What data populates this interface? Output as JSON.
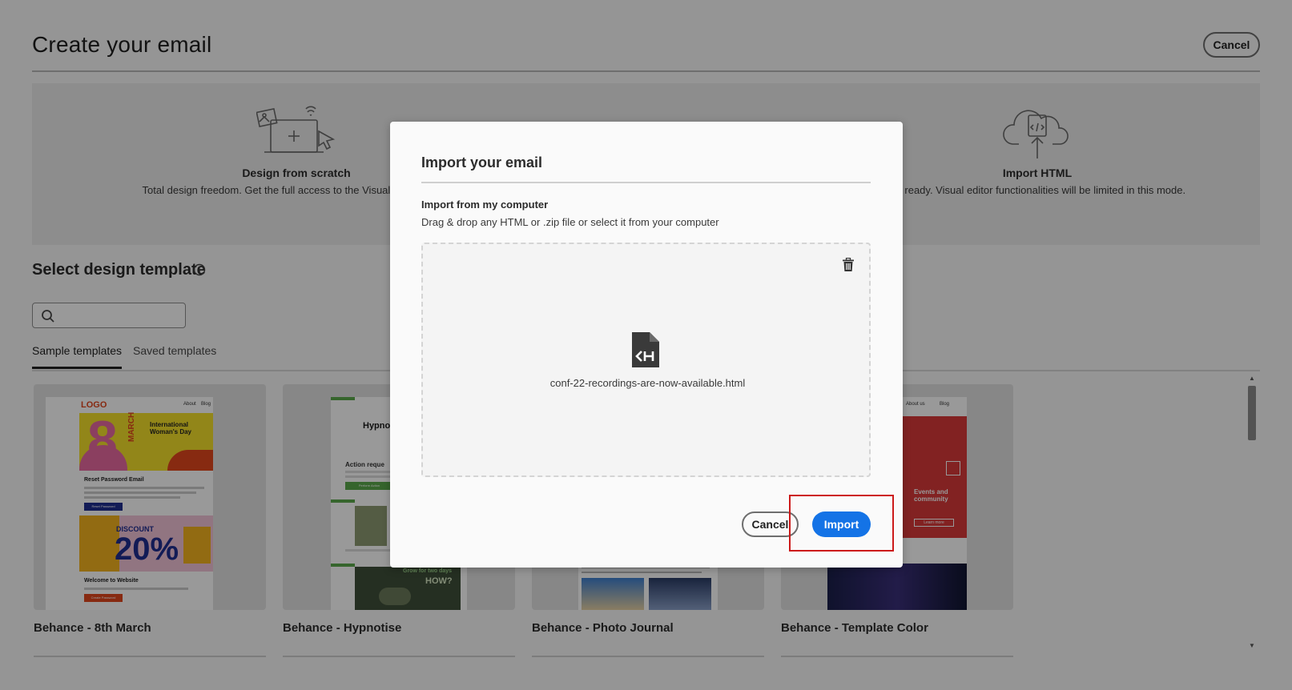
{
  "page": {
    "title": "Create your email",
    "cancel_label": "Cancel"
  },
  "options": {
    "scratch": {
      "title": "Design from scratch",
      "description": "Total design freedom. Get the full access to the Visual editor capab"
    },
    "import_html": {
      "title": "Import HTML",
      "description": "kly ready. Visual editor functionalities will be limited in this mode."
    }
  },
  "templates_section": {
    "title": "Select design template",
    "search": {
      "value": "",
      "placeholder": ""
    },
    "tabs": [
      {
        "label": "Sample templates",
        "active": true
      },
      {
        "label": "Saved templates",
        "active": false
      }
    ],
    "cards": [
      {
        "label": "Behance - 8th March"
      },
      {
        "label": "Behance - Hypnotise"
      },
      {
        "label": "Behance - Photo Journal"
      },
      {
        "label": "Behance - Template Color"
      }
    ],
    "thumb_text": {
      "logo": "LOGO",
      "about": "About",
      "blog": "Blog",
      "big_number": "8",
      "march": "MARCH",
      "iwd": "International Woman's Day",
      "reset_title": "Reset Password Email",
      "reset_btn": "Reset Password",
      "discount": "DISCOUNT",
      "percent": "20%",
      "welcome": "Welcome to Website",
      "welcome_btn": "Create Password",
      "hyp_heading": "Hypno Into T Chris",
      "hyp_action": "Action reque",
      "hyp_btn": "Perform Action",
      "hyp_grow": "Grow for two days",
      "hyp_how": "HOW?",
      "color_about": "About us",
      "color_blog": "Blog",
      "color_events": "Events and community",
      "color_learn": "Learn more"
    }
  },
  "dialog": {
    "title": "Import your email",
    "subtitle": "Import from my computer",
    "description": "Drag & drop any HTML or .zip file or select it from your computer",
    "file_name": "conf-22-recordings-are-now-available.html",
    "cancel_label": "Cancel",
    "import_label": "Import"
  },
  "colors": {
    "accent": "#1473e6",
    "highlight": "#cc1a1a"
  }
}
